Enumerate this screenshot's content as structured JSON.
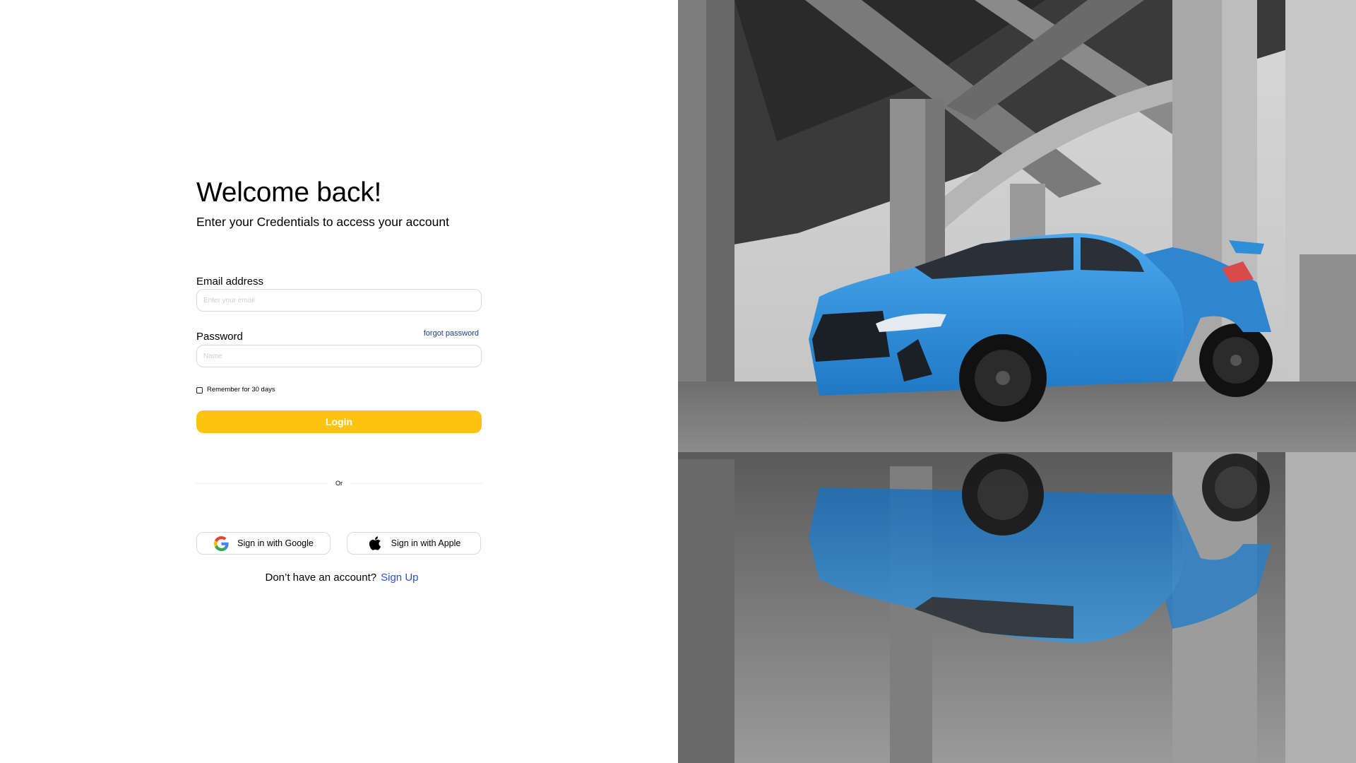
{
  "login": {
    "title": "Welcome back!",
    "subtitle": "Enter your Credentials to access your account",
    "email": {
      "label": "Email address",
      "placeholder": "Enter your email",
      "value": ""
    },
    "password": {
      "label": "Password",
      "placeholder": "Name",
      "value": "",
      "forgot_label": "forgot password"
    },
    "remember": {
      "label": "Remember for 30 days",
      "checked": false
    },
    "login_button_label": "Login",
    "divider_label": "Or",
    "social": {
      "google_label": "Sign in with Google",
      "google_icon": "google-icon",
      "apple_label": "Sign in with Apple",
      "apple_icon": "apple-icon"
    },
    "signup": {
      "prompt": "Don’t have an account?",
      "link_label": "Sign Up"
    }
  },
  "hero": {
    "description_icon": "car-photo",
    "car_color": "#2e8fd6"
  },
  "colors": {
    "accent": "#fcc310",
    "link": "#2750d8",
    "forgot_link": "#1a3c8e",
    "input_border": "#d9d9d9"
  }
}
